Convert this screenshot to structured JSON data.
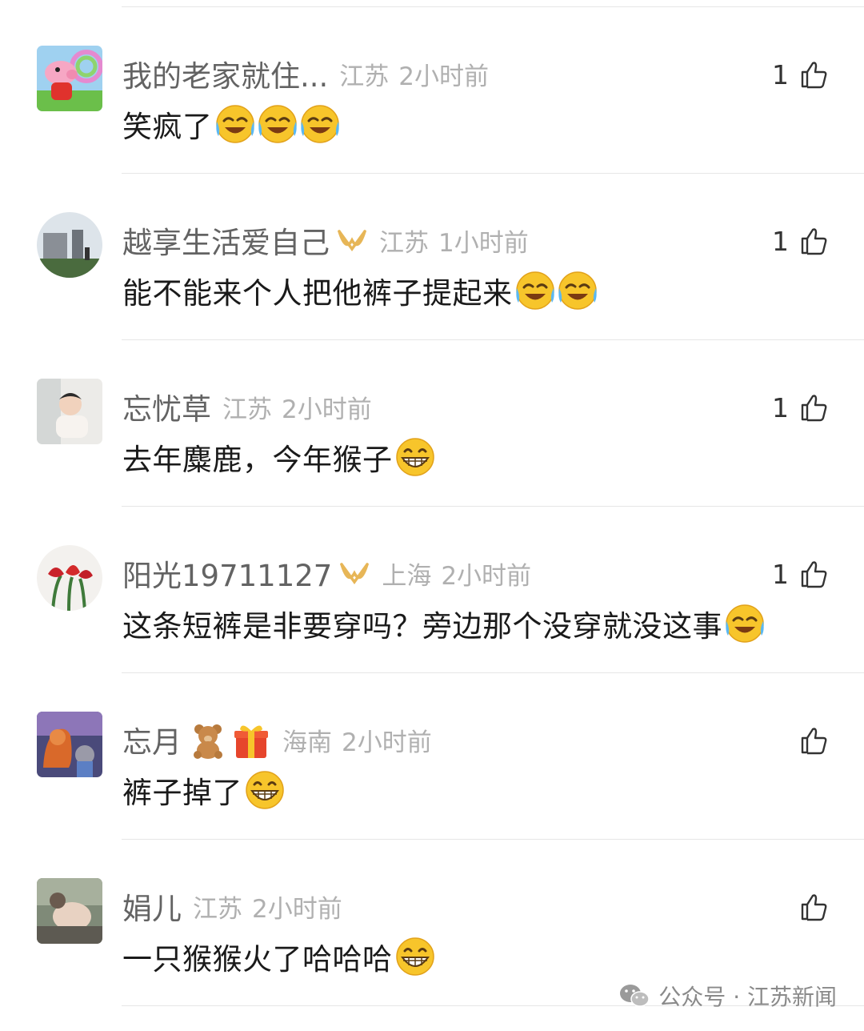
{
  "comments": [
    {
      "username": "我的老家就住...",
      "badge": "",
      "location": "江苏",
      "time": "2小时前",
      "text": "笑疯了",
      "emojis": [
        "laugh-cry-emoji",
        "laugh-cry-emoji",
        "laugh-cry-emoji"
      ],
      "likes": "1"
    },
    {
      "username": "越享生活爱自己",
      "badge": "vip-badge-icon",
      "location": "江苏",
      "time": "1小时前",
      "text": "能不能来个人把他裤子提起来",
      "emojis": [
        "laugh-cry-emoji",
        "laugh-cry-emoji"
      ],
      "likes": "1"
    },
    {
      "username": "忘忧草",
      "badge": "",
      "location": "江苏",
      "time": "2小时前",
      "text": "去年麋鹿，今年猴子",
      "emojis": [
        "grin-emoji"
      ],
      "likes": "1"
    },
    {
      "username": "阳光19711127",
      "badge": "vip-badge-icon",
      "location": "上海",
      "time": "2小时前",
      "text": "这条短裤是非要穿吗？旁边那个没穿就没这事",
      "emojis": [
        "laugh-cry-emoji"
      ],
      "likes": "1"
    },
    {
      "username": "忘月",
      "badge": "teddy-bear-gift-icons",
      "location": "海南",
      "time": "2小时前",
      "text": "裤子掉了",
      "emojis": [
        "grin-emoji"
      ],
      "likes": ""
    },
    {
      "username": "娟儿",
      "badge": "",
      "location": "江苏",
      "time": "2小时前",
      "text": "一只猴猴火了哈哈哈",
      "emojis": [
        "grin-emoji"
      ],
      "likes": ""
    }
  ],
  "watermark": {
    "text": "公众号 · 江苏新闻",
    "icon": "wechat-icon"
  },
  "colors": {
    "username": "#636363",
    "meta": "#b0b0b0",
    "text": "#1a1a1a",
    "divider": "#e6e6e6",
    "emoji": "#f7c52b",
    "vip": "#e7b657"
  }
}
